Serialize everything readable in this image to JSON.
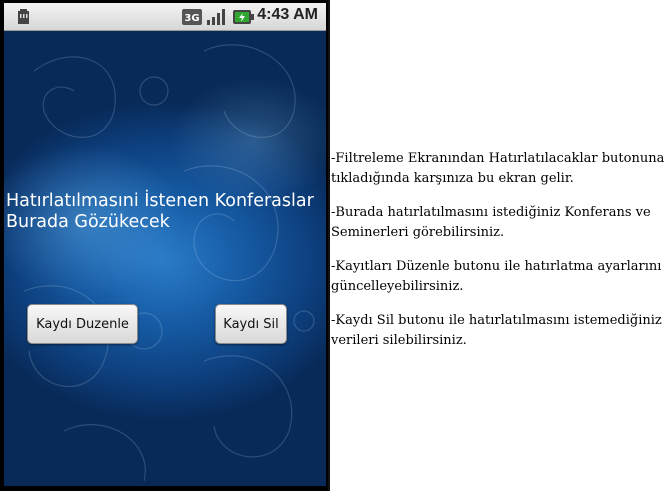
{
  "statusbar": {
    "time": "4:43 AM",
    "left_icon": "sd-card-icon",
    "network_label": "3G",
    "signal_icon": "signal-icon",
    "battery_icon": "battery-charging-icon"
  },
  "app": {
    "info_text": "Hatırlatılmasıni İstenen Konferaslar Burada Gözükecek",
    "edit_button_label": "Kaydı Duzenle",
    "delete_button_label": "Kaydı Sil"
  },
  "document": {
    "paragraphs": [
      "  -Filtreleme Ekranından Hatırlatılacaklar butonuna tıkladığında karşınıza bu ekran gelir.",
      "  -Burada hatırlatılmasını istediğiniz Konferans ve Seminerleri görebilirsiniz.",
      "  -Kayıtları Düzenle butonu ile hatırlatma ayarlarını güncelleyebilirsiniz.",
      "  -Kaydı Sil butonu ile hatırlatılmasını istemediğiniz verileri silebilirsiniz."
    ]
  },
  "colors": {
    "app_background": "#165ba4",
    "battery_accent": "#2fa62f"
  }
}
